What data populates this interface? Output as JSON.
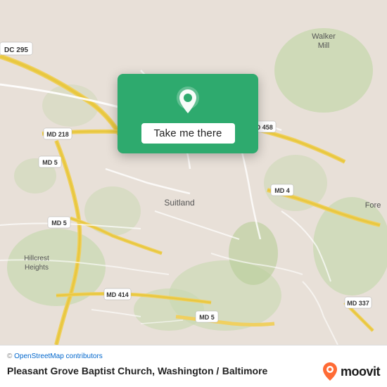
{
  "map": {
    "background_color": "#e8e0d8",
    "center": "Suitland, MD"
  },
  "popup": {
    "button_label": "Take me there",
    "pin_color": "#ffffff",
    "background_color": "#2eaa6e"
  },
  "bottom_bar": {
    "copyright": "© OpenStreetMap contributors",
    "location_name": "Pleasant Grove Baptist Church, Washington /",
    "location_city": "Baltimore",
    "moovit_logo_text": "moovit"
  }
}
